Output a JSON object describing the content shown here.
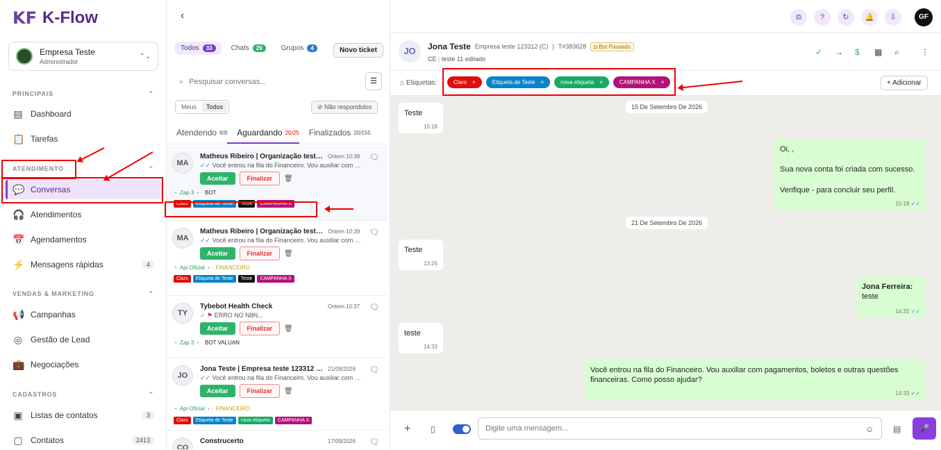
{
  "brand": {
    "logo_mark": "KF",
    "name": "K-Flow"
  },
  "company": {
    "name": "Empresa Teste",
    "role": "Administrador"
  },
  "sidebar": {
    "sections": [
      {
        "title": "PRINCIPAIS"
      },
      {
        "title": "ATENDIMENTO"
      },
      {
        "title": "VENDAS & MARKETING"
      },
      {
        "title": "CADASTROS"
      }
    ],
    "items": [
      {
        "label": "Dashboard"
      },
      {
        "label": "Tarefas"
      },
      {
        "label": "Conversas"
      },
      {
        "label": "Atendimentos"
      },
      {
        "label": "Agendamentos"
      },
      {
        "label": "Mensagens rápidas",
        "count": "4"
      },
      {
        "label": "Campanhas"
      },
      {
        "label": "Gestão de Lead"
      },
      {
        "label": "Negociações"
      },
      {
        "label": "Listas de contatos",
        "count": "3"
      },
      {
        "label": "Contatos",
        "count": "2413"
      }
    ]
  },
  "list": {
    "filters": [
      {
        "label": "Todos",
        "count": "33"
      },
      {
        "label": "Chats",
        "count": "29"
      },
      {
        "label": "Grupos",
        "count": "4"
      }
    ],
    "new_ticket": "Novo ticket",
    "search_placeholder": "Pesquisar conversas...",
    "seg": [
      "Meus",
      "Todos"
    ],
    "no_reply": "Não respondidos",
    "status_tabs": [
      {
        "label": "Atendendo",
        "count": "8/8"
      },
      {
        "label": "Aguardando",
        "count": "20/25"
      },
      {
        "label": "Finalizados",
        "count": "20/155"
      }
    ],
    "accept": "Aceitar",
    "finish": "Finalizar",
    "conversations": [
      {
        "initials": "MA",
        "name": "Matheus Ribeiro | Organização teste ...",
        "time": "Ontem 10:39",
        "preview": "Você entrou na fila do Financeiro. Vou auxiliar com p...",
        "channel": "Zap 3",
        "queue": "BOT",
        "tags": [
          {
            "label": "Claro",
            "color": "#e00d0d"
          },
          {
            "label": "Etiqueta de Teste",
            "color": "#0a84c6"
          },
          {
            "label": "Teste",
            "color": "#111111"
          },
          {
            "label": "CAMPANHA X",
            "color": "#b5117a"
          }
        ]
      },
      {
        "initials": "MA",
        "name": "Matheus Ribeiro | Organização teste ...",
        "time": "Ontem 10:39",
        "preview": "Você entrou na fila do Financeiro. Vou auxiliar com p...",
        "channel": "Api Oficial",
        "queue": "FINANCEIRO",
        "tags": [
          {
            "label": "Claro",
            "color": "#e00d0d"
          },
          {
            "label": "Etiqueta de Teste",
            "color": "#0a84c6"
          },
          {
            "label": "Teste",
            "color": "#111111"
          },
          {
            "label": "CAMPANHA X",
            "color": "#b5117a"
          }
        ]
      },
      {
        "initials": "TY",
        "name": "Tybebot Health Check",
        "time": "Ontem 10:37",
        "preview": "ERRO NO N8N...",
        "channel": "Zap 3",
        "queue": "BOT VALUAN",
        "tags": []
      },
      {
        "initials": "JO",
        "name": "Jona Teste | Empresa teste 123312 (C)",
        "time": "21/09/2026",
        "preview": "Você entrou na fila do Financeiro. Vou auxiliar com p...",
        "channel": "Api Oficial",
        "queue": "FINANCEIRO",
        "tags": [
          {
            "label": "Claro",
            "color": "#e00d0d"
          },
          {
            "label": "Etiqueta de Teste",
            "color": "#0a84c6"
          },
          {
            "label": "nova etiqueta",
            "color": "#1aa866"
          },
          {
            "label": "CAMPANHA X",
            "color": "#b5117a"
          }
        ]
      },
      {
        "initials": "CO",
        "name": "Construcerto",
        "time": "17/09/2026",
        "preview": "",
        "channel": "",
        "queue": "",
        "tags": []
      }
    ]
  },
  "topbar": {
    "user_initials": "GF"
  },
  "chat": {
    "initials": "JO",
    "name": "Jona Teste",
    "company": "Empresa teste 123312 (C)",
    "ticket": "T#383628",
    "bot_status": "Bot Pausado",
    "state": "CE",
    "edited": "teste 11 editado",
    "tags_label": "Etiquetas:",
    "tags": [
      {
        "label": "Claro",
        "color": "#e00d0d"
      },
      {
        "label": "Etiqueta de Teste",
        "color": "#0a84c6"
      },
      {
        "label": "nova etiqueta",
        "color": "#1aa866"
      },
      {
        "label": "CAMPANHA X",
        "color": "#b5117a"
      }
    ],
    "add_label": "+ Adicionar",
    "dates": [
      "15 De Setembro De 2026",
      "21 De Setembro De 2026"
    ],
    "messages": [
      {
        "text": "Teste",
        "time": "15:18"
      },
      {
        "line1": "Oi, ,",
        "line2": "Sua nova conta foi criada com sucesso.",
        "line3": "Verifique - para concluir seu perfil.",
        "time": "15:18"
      },
      {
        "text": "Teste",
        "time": "13:26"
      },
      {
        "author": "Jona Ferreira:",
        "text": "teste",
        "time": "14:32"
      },
      {
        "text": "teste",
        "time": "14:33"
      },
      {
        "text": "Você entrou na fila do Financeiro. Vou auxiliar com pagamentos, boletos e outras questões financeiras. Como posso ajudar?",
        "time": "14:33"
      }
    ],
    "input_placeholder": "Digite uma mensagem..."
  }
}
